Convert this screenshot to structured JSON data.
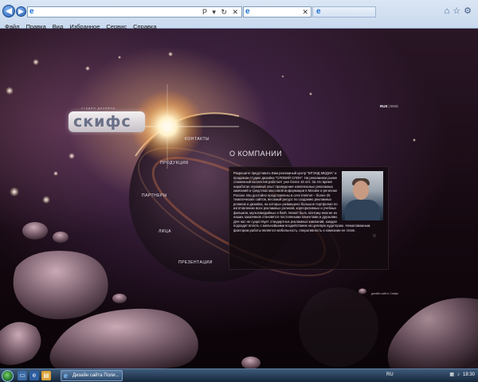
{
  "browser": {
    "menu": [
      "Файл",
      "Правка",
      "Вид",
      "Избранное",
      "Сервис",
      "Справка"
    ],
    "address_tools": "P ▾ ↻ ✕",
    "tab_close": "✕"
  },
  "site": {
    "logo_tagline": "студия дизайна",
    "logo_text": "скифс",
    "nav": [
      "Контакты",
      "Продукция",
      "Партнеры",
      "Лица",
      "Презентации"
    ],
    "section_title": "О КОМПАНИИ",
    "about_text": "Разрешите представить Вам рекламный центр \"БРЭНД МЕДИА\" и продакшн-студию дизайна \"СЛОВИЙ СЛОН\". На рекламном рынке слаженный коллектив работает уже более 16 лет. За это время наработан огромный опыт проведения комплексных рекламных кампаний и средствах массовой информации в Москве и регионах России. Мы достойно представлены в сети Internet – более 25 тематических сайтов, весомый ресурс по созданию рекламных роликов и дизайна, на которых размещено большое портфолио по изготовлению всех рекламных роликов, корпоративных и учебных фильмов, мультимедийных и flash. Может быть поэтому многие из наших заказчиков становятся постоянными клиентами и друзьями. Для нас не существует стандартных рекламных кампаний, каждая подходит вплоть с мельчайшими воздействием на целевую аудиторию. Немаловажным фактором работы является мобильность, оперативность и компании ее этапе.",
    "lang_switch_active": "RUS",
    "lang_switch_other": "ENG",
    "credit": "дизайн сайта: Скифс"
  },
  "taskbar": {
    "task_label": "Дизайн сайта Поли...",
    "language": "RU",
    "clock": "18:30"
  },
  "icons": {
    "back": "back-arrow-icon",
    "forward": "forward-arrow-icon",
    "home": "home-icon",
    "favorites": "favorites-star-icon",
    "tools": "gear-icon",
    "start": "windows-start-icon"
  },
  "colors": {
    "chrome": "#c9d9ee",
    "panel": "#120a0e",
    "taskbar": "#16263a"
  }
}
